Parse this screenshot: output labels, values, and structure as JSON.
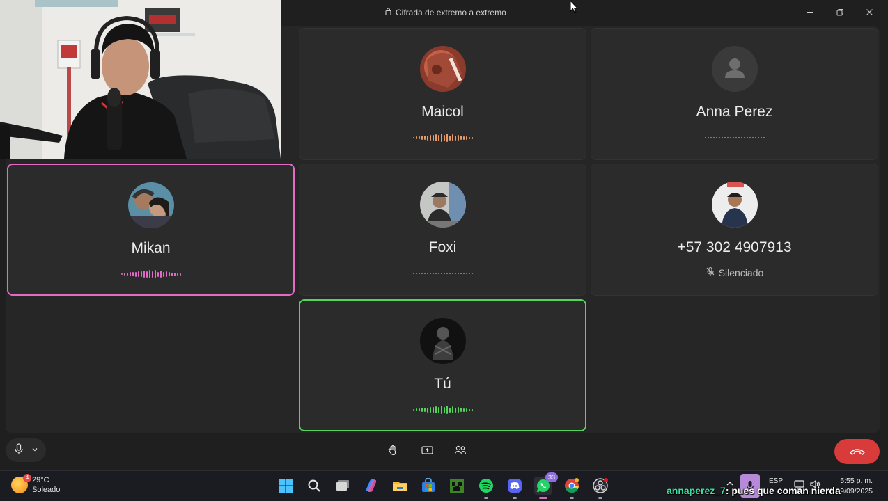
{
  "window": {
    "title": "Cifrada de extremo a extremo",
    "lock_icon": "lock-icon",
    "controls": [
      "minimize",
      "restore",
      "close"
    ]
  },
  "participants": [
    {
      "name": "Maicol",
      "state": "speaking",
      "wave_color": "#e89a6a"
    },
    {
      "name": "Anna Perez",
      "state": "idle",
      "wave_color": "#c98a5e"
    },
    {
      "name": "Mikan",
      "state": "speaking",
      "wave_color": "#e36bc8",
      "highlight": "#e36bc8"
    },
    {
      "name": "Foxi",
      "state": "idle",
      "wave_color": "#4fc15a"
    },
    {
      "name": "+57 302 4907913",
      "state": "muted",
      "status_label": "Silenciado"
    },
    {
      "name": "Tú",
      "state": "speaking",
      "wave_color": "#55d45c",
      "highlight": "#55d45c"
    }
  ],
  "call_controls": {
    "mic": "microphone-icon",
    "mic_options": "chevron-down-icon",
    "raise_hand": "hand-icon",
    "share_screen": "share-screen-icon",
    "add_people": "people-icon",
    "hang_up": "phone-hangup-icon",
    "hang_up_color": "#d93a3a"
  },
  "taskbar": {
    "weather_badge": "4",
    "temperature": "29°C",
    "condition": "Soleado",
    "apps": [
      "windows-start",
      "search",
      "task-view",
      "copilot",
      "file-explorer",
      "microsoft-store",
      "minecraft",
      "spotify",
      "discord",
      "whatsapp",
      "chrome",
      "obs"
    ],
    "whatsapp_badge": "33",
    "language": "ESP",
    "time": "5:55 p. m.",
    "date": "9/09/2025"
  },
  "chat_overlay": {
    "user": "annaperez_7",
    "message": ": pues que coman nierda"
  }
}
